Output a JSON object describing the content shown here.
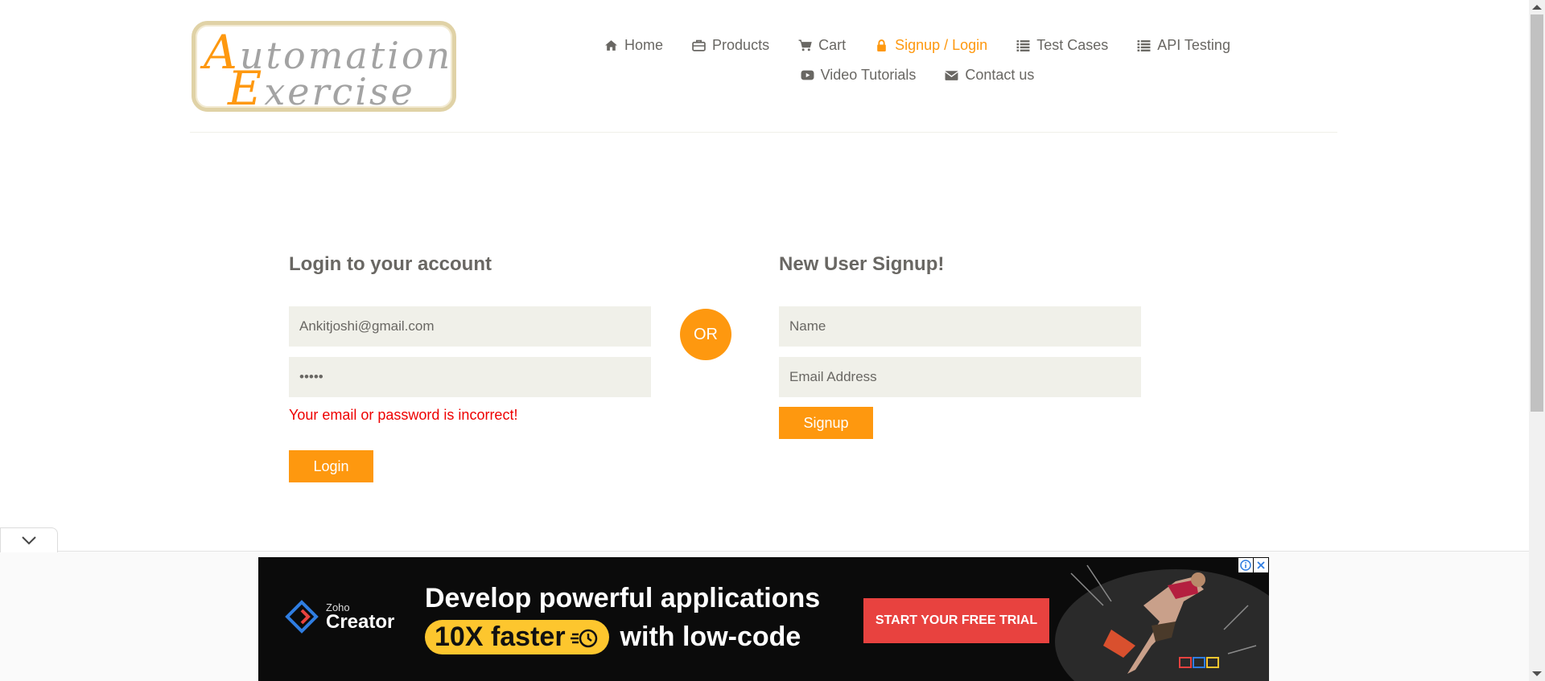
{
  "logo": {
    "cap1": "A",
    "rest1": "utomation",
    "cap2": "E",
    "rest2": "xercise"
  },
  "nav": {
    "row1": [
      {
        "label": "Home",
        "icon": "home-icon"
      },
      {
        "label": "Products",
        "icon": "briefcase-icon"
      },
      {
        "label": "Cart",
        "icon": "cart-icon"
      },
      {
        "label": "Signup / Login",
        "icon": "lock-icon",
        "active": true
      },
      {
        "label": "Test Cases",
        "icon": "list-icon"
      },
      {
        "label": "API Testing",
        "icon": "list-icon"
      }
    ],
    "row2": [
      {
        "label": "Video Tutorials",
        "icon": "youtube-play-icon"
      },
      {
        "label": "Contact us",
        "icon": "envelope-icon"
      }
    ]
  },
  "login": {
    "title": "Login to your account",
    "email_value": "Ankitjoshi@gmail.com",
    "password_value": "•••••",
    "error": "Your email or password is incorrect!",
    "button": "Login"
  },
  "or_label": "OR",
  "signup": {
    "title": "New User Signup!",
    "name_placeholder": "Name",
    "email_placeholder": "Email Address",
    "button": "Signup"
  },
  "ad": {
    "brand_small": "Zoho",
    "brand_big": "Creator",
    "headline1": "Develop powerful applications",
    "pill_text": "10X faster",
    "headline2_rest": "with low-code",
    "cta": "START YOUR FREE TRIAL"
  },
  "colors": {
    "accent": "#fe980f",
    "input_bg": "#f0f0e9",
    "error": "#ee0000",
    "ad_cta": "#e8423f"
  }
}
